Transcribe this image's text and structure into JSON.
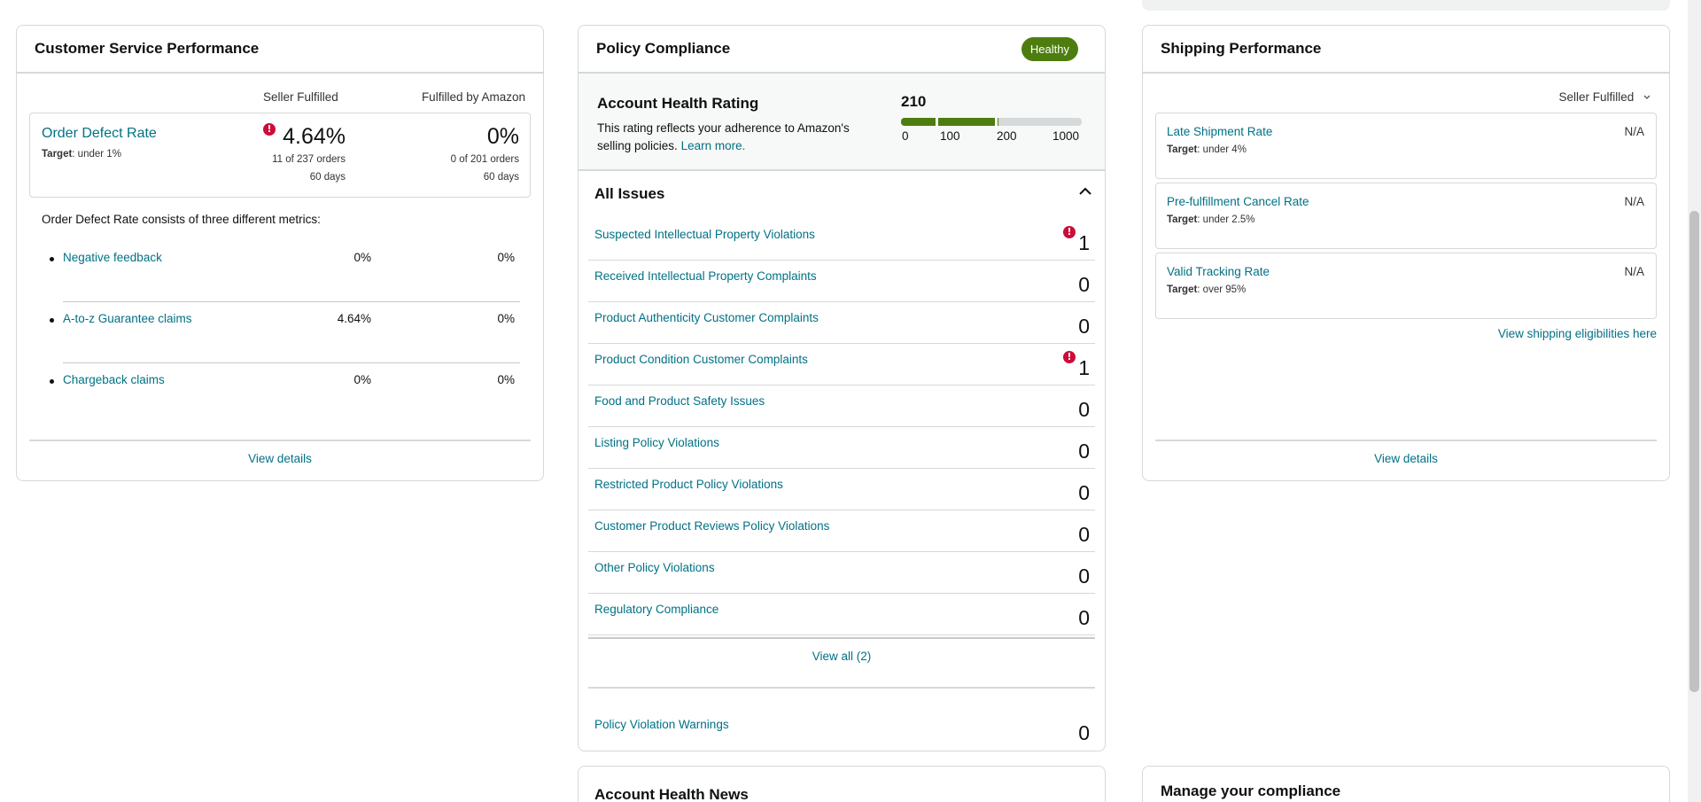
{
  "csp": {
    "title": "Customer Service Performance",
    "col_seller": "Seller Fulfilled",
    "col_fba": "Fulfilled by Amazon",
    "odr": {
      "name": "Order Defect Rate",
      "target_label": "Target",
      "target_value": ": under 1%",
      "seller_value": "4.64%",
      "seller_orders": "11 of 237 orders",
      "seller_days": "60 days",
      "fba_value": "0%",
      "fba_orders": "0 of 201 orders",
      "fba_days": "60 days"
    },
    "description": "Order Defect Rate consists of three different metrics:",
    "metrics": [
      {
        "name": "Negative feedback",
        "seller": "0%",
        "fba": "0%"
      },
      {
        "name": "A-to-z Guarantee claims",
        "seller": "4.64%",
        "fba": "0%"
      },
      {
        "name": "Chargeback claims",
        "seller": "0%",
        "fba": "0%"
      }
    ],
    "view_details": "View details"
  },
  "pc": {
    "title": "Policy Compliance",
    "status_badge": "Healthy",
    "ahr_title": "Account Health Rating",
    "ahr_desc": "This rating reflects your adherence to Amazon's selling policies.",
    "learn_more": "Learn more.",
    "score": "210",
    "score_value": 210,
    "scale_labels": [
      "0",
      "100",
      "200",
      "1000"
    ],
    "issues_title": "All Issues",
    "issues": [
      {
        "name": "Suspected Intellectual Property Violations",
        "count": "1",
        "alert": true
      },
      {
        "name": "Received Intellectual Property Complaints",
        "count": "0",
        "alert": false
      },
      {
        "name": "Product Authenticity Customer Complaints",
        "count": "0",
        "alert": false
      },
      {
        "name": "Product Condition Customer Complaints",
        "count": "1",
        "alert": true
      },
      {
        "name": "Food and Product Safety Issues",
        "count": "0",
        "alert": false
      },
      {
        "name": "Listing Policy Violations",
        "count": "0",
        "alert": false
      },
      {
        "name": "Restricted Product Policy Violations",
        "count": "0",
        "alert": false
      },
      {
        "name": "Customer Product Reviews Policy Violations",
        "count": "0",
        "alert": false
      },
      {
        "name": "Other Policy Violations",
        "count": "0",
        "alert": false
      },
      {
        "name": "Regulatory Compliance",
        "count": "0",
        "alert": false
      }
    ],
    "view_all": "View all (2)",
    "warnings_label": "Policy Violation Warnings",
    "warnings_count": "0"
  },
  "sp": {
    "title": "Shipping Performance",
    "dropdown": "Seller Fulfilled",
    "metrics": [
      {
        "name": "Late Shipment Rate",
        "target_label": "Target",
        "target_value": ": under 4%",
        "value": "N/A"
      },
      {
        "name": "Pre-fulfillment Cancel Rate",
        "target_label": "Target",
        "target_value": ": under 2.5%",
        "value": "N/A"
      },
      {
        "name": "Valid Tracking Rate",
        "target_label": "Target",
        "target_value": ": over 95%",
        "value": "N/A"
      }
    ],
    "eligibility_link": "View shipping eligibilities here",
    "view_details": "View details"
  },
  "news": {
    "title": "Account Health News"
  },
  "manage": {
    "title": "Manage your compliance"
  },
  "icons": {
    "alert": "exclamation-circle-icon",
    "collapse": "chevron-up-icon",
    "dropdown": "chevron-down-icon"
  },
  "colors": {
    "link": "#007185",
    "healthy": "#4e7d0f",
    "alert": "#cc0c39",
    "border": "#d5d9d9"
  }
}
